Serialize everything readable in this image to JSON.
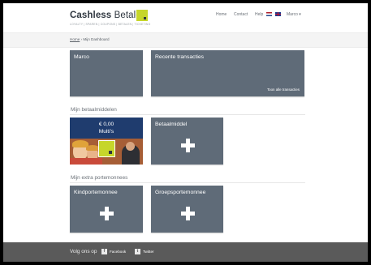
{
  "header": {
    "logo_bold": "Cashless",
    "logo_light": "Betalen",
    "tagline": "LOYALTY | SPAREN | COUPONS | BETALEN | TICKETING",
    "nav": {
      "home": "Home",
      "contact": "Contact",
      "help": "Help",
      "user": "Marco ▾"
    }
  },
  "breadcrumb": {
    "home": "Home",
    "separator": "›",
    "current": "Mijn Dashboard"
  },
  "dashboard": {
    "profile_tile": "Marco",
    "transactions_tile": {
      "title": "Recente transacties",
      "link": "Toon alle transacties"
    }
  },
  "betaalmiddelen": {
    "title": "Mijn betaalmiddelen",
    "card": {
      "amount": "€ 0,00",
      "name": "Multi's"
    },
    "add_tile": "Betaalmiddel"
  },
  "portemonnees": {
    "title": "Mijn extra portemonnees",
    "kind": "Kindportemonnee",
    "groep": "Groepsportemonnee"
  },
  "footer": {
    "follow": "Volg ons op",
    "facebook": "Facebook",
    "twitter": "Twitter"
  },
  "colors": {
    "tile": "#5f6b78",
    "brand_accent": "#c6d62b",
    "footer": "#5a5a5a"
  }
}
